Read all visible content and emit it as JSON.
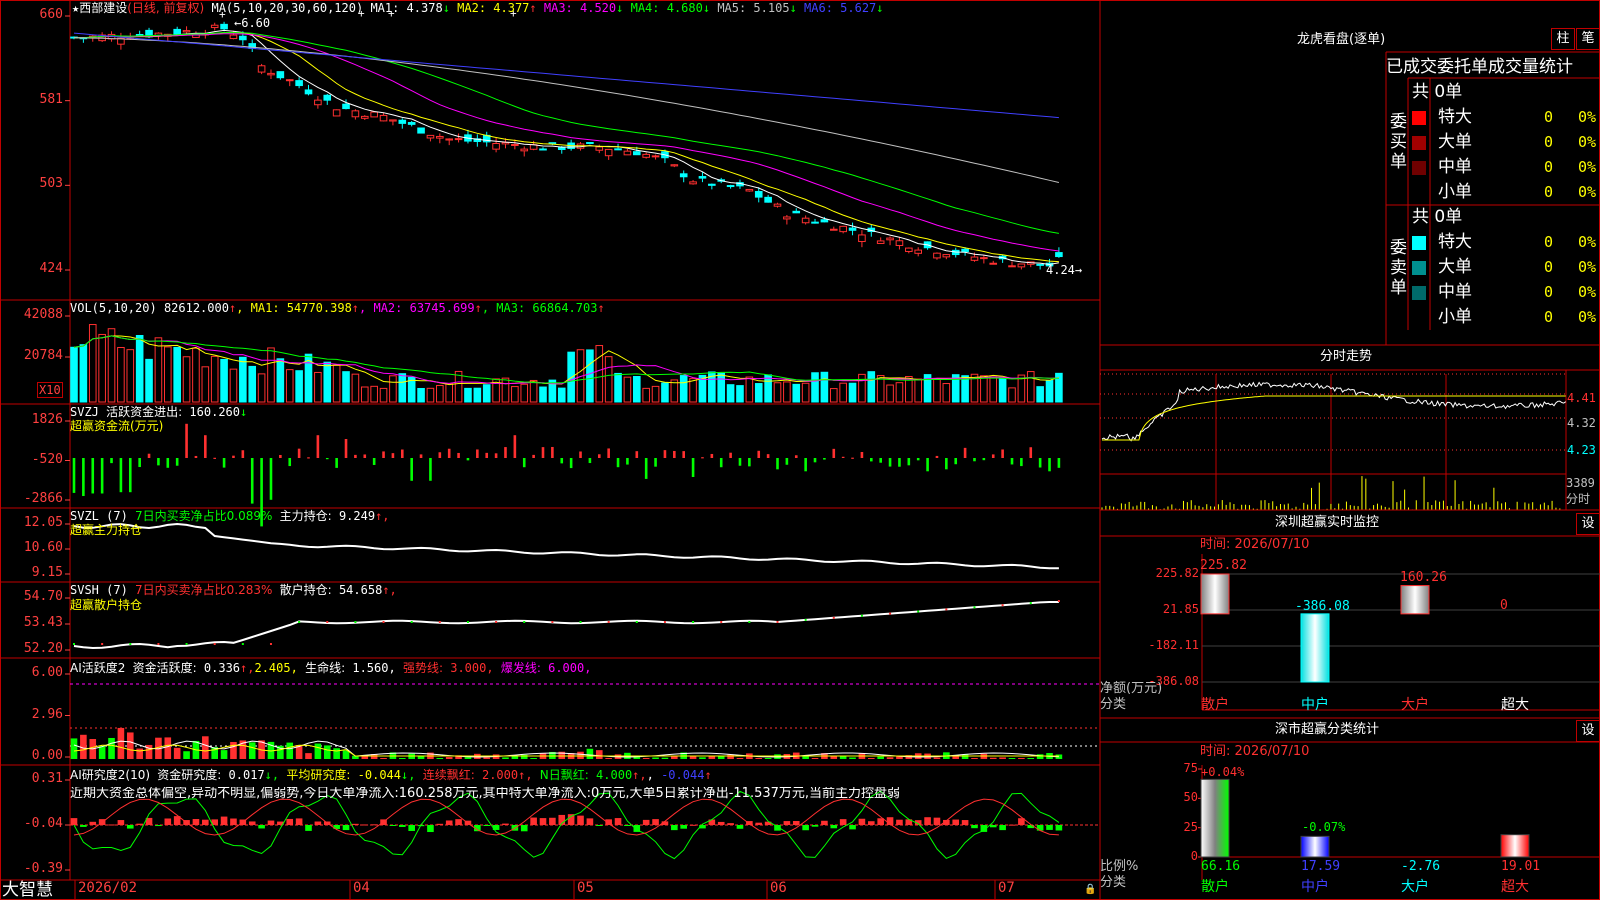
{
  "app": {
    "name": "大智慧"
  },
  "stock": {
    "name": "西部建设",
    "period": "(日线, 前复权)"
  },
  "main": {
    "yticks": [
      "660",
      "581",
      "503",
      "424"
    ],
    "high_label": "6.60",
    "low_label": "4.24",
    "ma_header": "MA(5,10,20,30,60,120)",
    "ma": [
      {
        "l": "MA1:",
        "v": "4.378",
        "a": "↓",
        "c": "#ffffff"
      },
      {
        "l": "MA2:",
        "v": "4.377",
        "a": "↑",
        "c": "#ffff00"
      },
      {
        "l": "MA3:",
        "v": "4.520",
        "a": "↓",
        "c": "#ff00ff"
      },
      {
        "l": "MA4:",
        "v": "4.680",
        "a": "↓",
        "c": "#00ff00"
      },
      {
        "l": "MA5:",
        "v": "5.105",
        "a": "↓",
        "c": "#c0c0c0"
      },
      {
        "l": "MA6:",
        "v": "5.627",
        "a": "↓",
        "c": "#4040ff"
      }
    ]
  },
  "vol": {
    "header": "VOL(5,10,20)",
    "value": "82612.000",
    "arrow": "↑",
    "ma": [
      {
        "l": "MA1:",
        "v": "54770.398",
        "a": "↑",
        "c": "#ffff00"
      },
      {
        "l": "MA2:",
        "v": "63745.699",
        "a": "↑",
        "c": "#ff00ff"
      },
      {
        "l": "MA3:",
        "v": "66864.703",
        "a": "↑",
        "c": "#00ff00"
      }
    ],
    "yticks": [
      "42088",
      "20784"
    ],
    "unit": "X10"
  },
  "svzj": {
    "name": "SVZJ",
    "label": "活跃资金进出:",
    "value": "160.260",
    "arrow": "↓",
    "subtitle": "超赢资金流(万元)",
    "yticks": [
      "1826",
      "-520",
      "-2866"
    ]
  },
  "svzl": {
    "name": "SVZL (7)",
    "label": "7日内买卖净占比0.089%",
    "label2": "主力持仓:",
    "value": "9.249",
    "arrow": "↑,",
    "subtitle": "超赢主力持仓",
    "yticks": [
      "12.05",
      "10.60",
      "9.15"
    ]
  },
  "svsh": {
    "name": "SVSH (7)",
    "label": "7日内买卖净占比0.283%",
    "label2": "散户持仓:",
    "value": "54.658",
    "arrow": "↑,",
    "subtitle": "超赢散户持仓",
    "yticks": [
      "54.70",
      "53.43",
      "52.20"
    ]
  },
  "ai1": {
    "name": "AI活跃度2",
    "l1": "资金活跃度:",
    "v1": "0.336",
    "a1": "↑,",
    "v2": "2.405,",
    "l3": "生命线:",
    "v3": "1.560,",
    "l4": "强势线:",
    "v4": "3.000,",
    "l5": "爆发线:",
    "v5": "6.000,",
    "yticks": [
      "6.00",
      "2.96",
      "0.00"
    ]
  },
  "ai2": {
    "name": "AI研究度2(10)",
    "l1": "资金研究度:",
    "v1": "0.017",
    "a1": "↓,",
    "l2": "平均研究度:",
    "v2": "-0.044",
    "a2": "↓,",
    "l3": "连续飘红:",
    "v3": "2.000",
    "a3": "↑,",
    "l4": "N日飘红:",
    "v4": "4.000",
    "a4": "↑,",
    "v5": "-0.044",
    "a5": "↑",
    "text": "近期大资金总体偏空,异动不明显,偏弱势,今日大单净流入:160.258万元,其中特大单净流入:0万元,大单5日累计净出-11.537万元,当前主力控盘弱",
    "yticks": [
      "0.31",
      "-0.04",
      "-0.39"
    ]
  },
  "xaxis": [
    {
      "t": "2026/02",
      "x": 78
    },
    {
      "t": "04",
      "x": 353
    },
    {
      "t": "05",
      "x": 577
    },
    {
      "t": "06",
      "x": 770
    },
    {
      "t": "07",
      "x": 998
    }
  ],
  "longhu": {
    "title": "龙虎看盘(逐单)",
    "btn1": "柱",
    "btn2": "笔",
    "header": "已成交委托单成交量统计",
    "buy": {
      "label": "委买单",
      "total": "共 0单",
      "rows": [
        {
          "n": "特大",
          "c": "#ff0000",
          "v": "0",
          "p": "0%"
        },
        {
          "n": "大单",
          "c": "#a00000",
          "v": "0",
          "p": "0%"
        },
        {
          "n": "中单",
          "c": "#700000",
          "v": "0",
          "p": "0%"
        },
        {
          "n": "小单",
          "c": "#000000",
          "v": "0",
          "p": "0%"
        }
      ]
    },
    "sell": {
      "label": "委卖单",
      "total": "共 0单",
      "rows": [
        {
          "n": "特大",
          "c": "#00ffff",
          "v": "0",
          "p": "0%"
        },
        {
          "n": "大单",
          "c": "#009090",
          "v": "0",
          "p": "0%"
        },
        {
          "n": "中单",
          "c": "#006a6a",
          "v": "0",
          "p": "0%"
        },
        {
          "n": "小单",
          "c": "#000000",
          "v": "0",
          "p": "0%"
        }
      ]
    }
  },
  "fenshi": {
    "title": "分时走势",
    "yticks": [
      "4.41",
      "4.32",
      "4.23"
    ],
    "vol_tick": "3389",
    "vol_label": "分时"
  },
  "monitor": {
    "title": "深圳超赢实时监控",
    "btn": "设",
    "time": "时间: 2026/07/10",
    "yticks": [
      "225.82",
      "21.85",
      "-182.11",
      "-386.08"
    ],
    "ylabel": "净额(万元)",
    "cat_label": "分类",
    "cats": [
      "散户",
      "中户",
      "大户",
      "超大"
    ],
    "values": [
      225.82,
      -386.08,
      160.26,
      0
    ],
    "labels": [
      "225.82",
      "-386.08",
      "160.26",
      "0"
    ]
  },
  "classify": {
    "title": "深市超赢分类统计",
    "btn": "设",
    "time": "时间: 2026/07/10",
    "yticks": [
      "75",
      "50",
      "25",
      "0"
    ],
    "ylabel": "比例%",
    "cat_label": "分类",
    "cats": [
      "散户",
      "中户",
      "大户",
      "超大"
    ],
    "values": [
      66.16,
      17.59,
      -2.76,
      19.01
    ],
    "labels": [
      "66.16",
      "17.59",
      "-2.76",
      "19.01"
    ],
    "changes": [
      "+0.04%",
      "-0.07%"
    ]
  }
}
